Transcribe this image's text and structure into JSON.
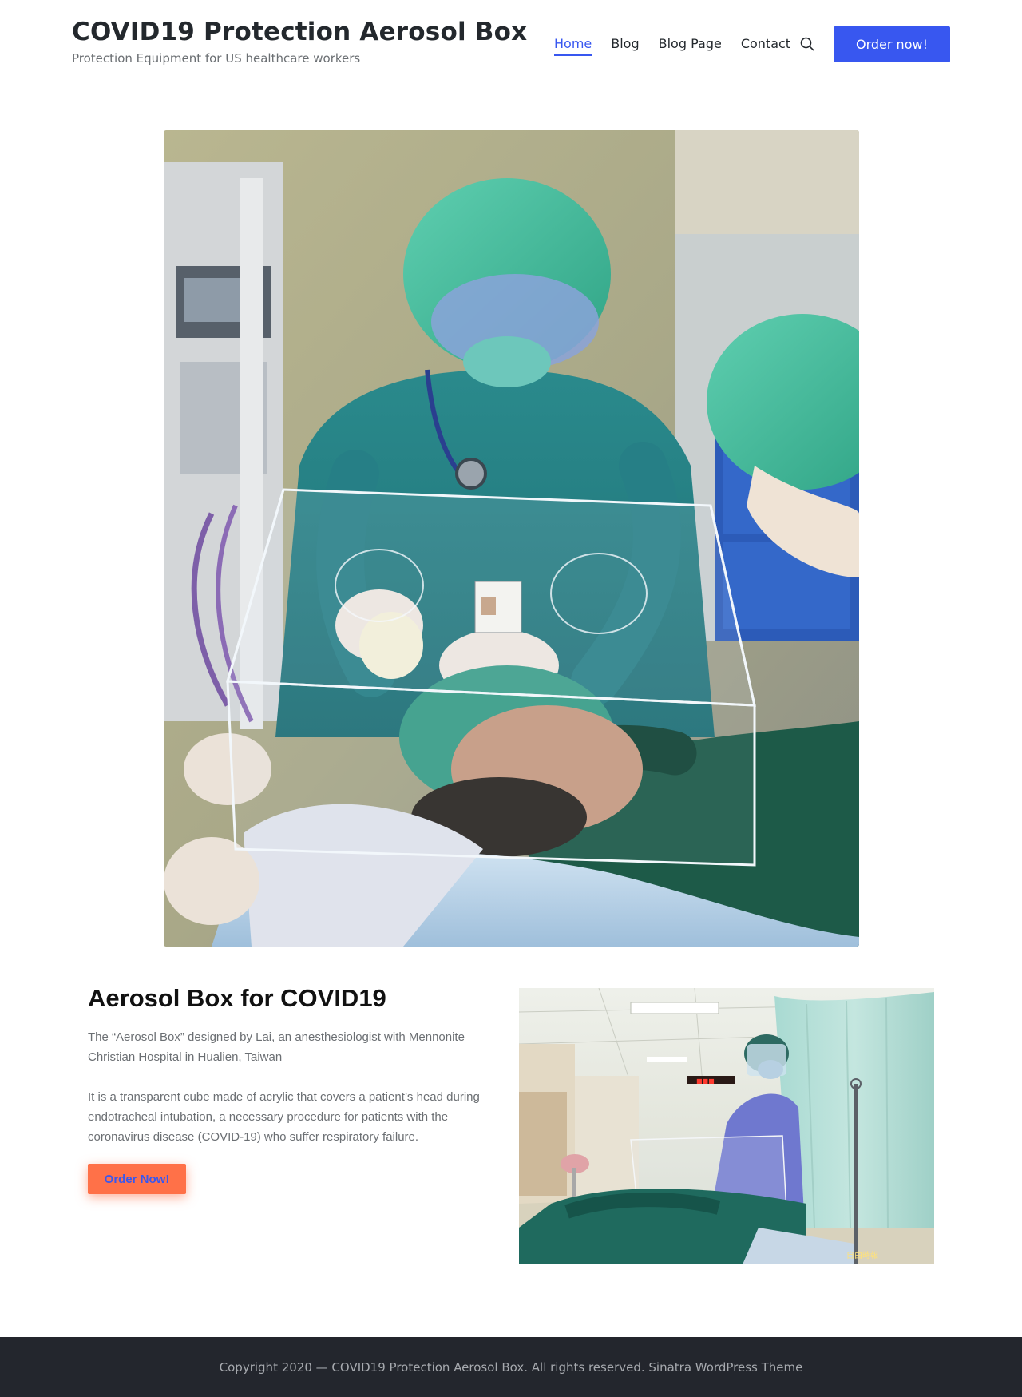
{
  "header": {
    "site_title": "COVID19 Protection Aerosol Box",
    "tagline": "Protection Equipment for US healthcare workers",
    "nav": [
      {
        "label": "Home",
        "active": true
      },
      {
        "label": "Blog",
        "active": false
      },
      {
        "label": "Blog Page",
        "active": false
      },
      {
        "label": "Contact",
        "active": false
      }
    ],
    "search_icon": "search-icon",
    "order_button": "Order now!"
  },
  "hero": {
    "image": "photo-medical-staff-intubation-with-aerosol-box"
  },
  "content": {
    "heading": "Aerosol Box for COVID19",
    "paragraph_1": "The “Aerosol Box” designed by Lai, an anesthesiologist with Mennonite Christian Hospital in Hualien, Taiwan",
    "paragraph_2": "It is a transparent cube made of acrylic that covers a patient’s head during endotracheal intubation, a necessary procedure for patients with the coronavirus disease (COVID-19) who suffer respiratory failure.",
    "order_button": "Order Now!",
    "side_image": "photo-doctor-demonstrating-aerosol-box",
    "side_image_watermark": "自由時報"
  },
  "footer": {
    "text": "Copyright 2020 — COVID19 Protection Aerosol Box. All rights reserved. Sinatra WordPress Theme"
  },
  "colors": {
    "accent": "#3857f0",
    "cta": "#ff7148",
    "footer_bg": "#23262d"
  }
}
